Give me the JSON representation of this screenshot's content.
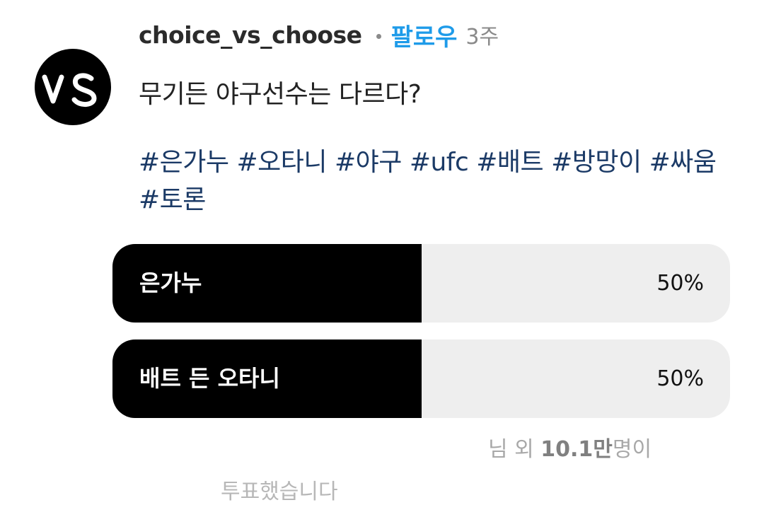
{
  "post": {
    "username": "choice_vs_choose",
    "follow_label": "팔로우",
    "time_ago": "3주",
    "question": "무기든 야구선수는 다르다?",
    "hashtags": [
      "#은가누",
      "#오타니",
      "#야구",
      "#ufc",
      "#배트",
      "#방망이",
      "#싸움",
      "#토론"
    ]
  },
  "poll": {
    "options": [
      {
        "label": "은가누",
        "percent_text": "50%",
        "percent": 50
      },
      {
        "label": "배트 든 오타니",
        "percent_text": "50%",
        "percent": 50
      }
    ],
    "voters_prefix": "님 외 ",
    "voters_count": "10.1만",
    "voters_suffix": "명이",
    "participated_text": "투표했습니다"
  },
  "colors": {
    "accent": "#1e9be9",
    "hashtag": "#1b3a66",
    "poll_fill": "#000000",
    "poll_track": "#eeeeee"
  },
  "icons": {
    "avatar": "vs-logo-avatar"
  }
}
